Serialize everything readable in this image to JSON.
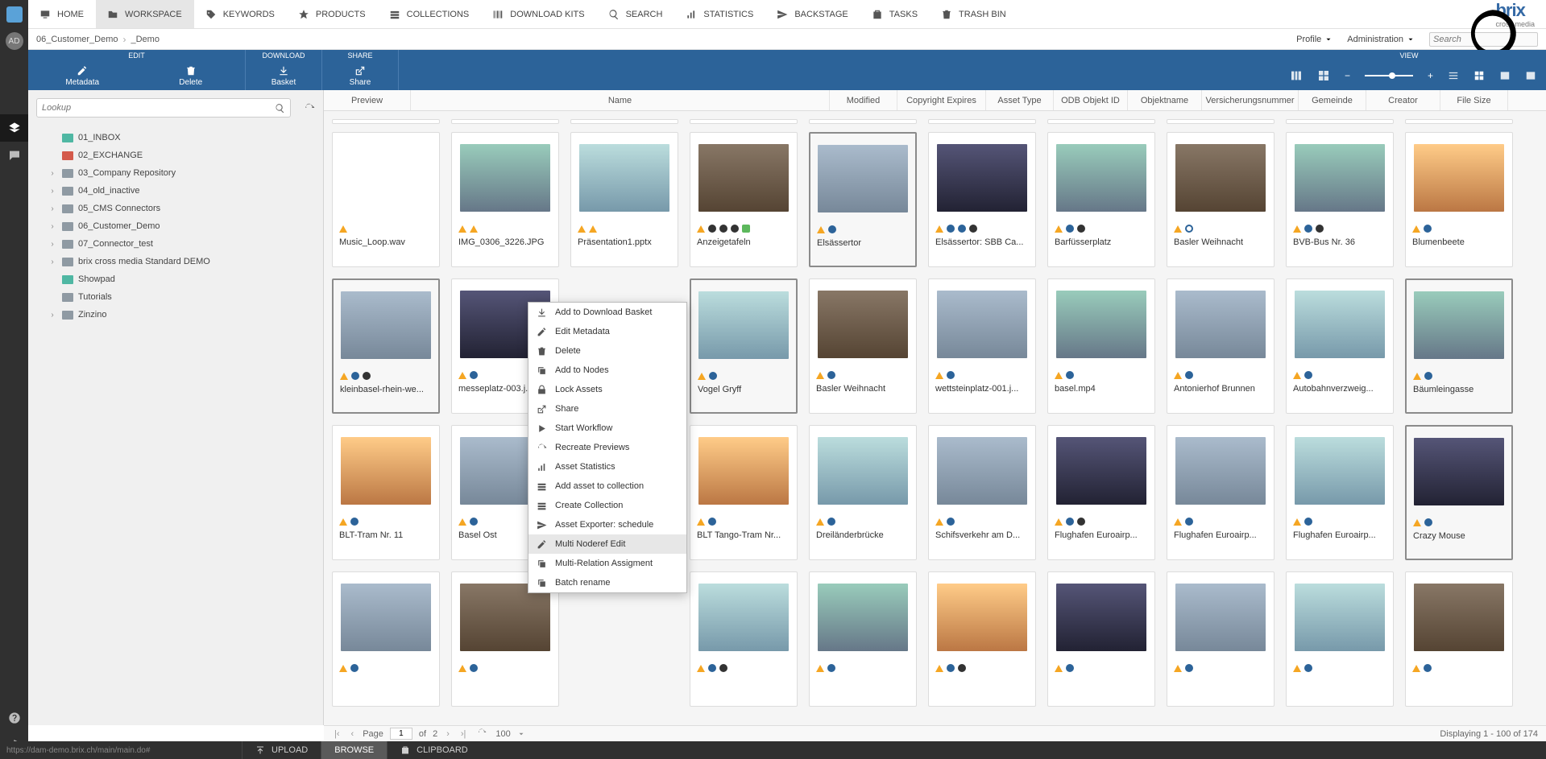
{
  "leftrail": {
    "avatar_initials": "AD"
  },
  "topnav": {
    "items": [
      {
        "label": "HOME",
        "icon": "monitor"
      },
      {
        "label": "WORKSPACE",
        "icon": "folder",
        "active": true
      },
      {
        "label": "KEYWORDS",
        "icon": "tag"
      },
      {
        "label": "PRODUCTS",
        "icon": "star"
      },
      {
        "label": "COLLECTIONS",
        "icon": "stack"
      },
      {
        "label": "DOWNLOAD KITS",
        "icon": "barcode"
      },
      {
        "label": "SEARCH",
        "icon": "search"
      },
      {
        "label": "STATISTICS",
        "icon": "bars"
      },
      {
        "label": "BACKSTAGE",
        "icon": "send"
      },
      {
        "label": "TASKS",
        "icon": "clipboard"
      },
      {
        "label": "TRASH BIN",
        "icon": "trash"
      }
    ],
    "brand_top": "brix",
    "brand_sub": "cross media"
  },
  "crumb": {
    "items": [
      "06_Customer_Demo",
      "_Demo"
    ],
    "profile_label": "Profile",
    "admin_label": "Administration",
    "search_placeholder": "Search"
  },
  "labelrow": {
    "edit": "EDIT",
    "download": "DOWNLOAD",
    "share": "SHARE",
    "view": "VIEW"
  },
  "actions": {
    "metadata": "Metadata",
    "delete": "Delete",
    "basket": "Basket",
    "share": "Share"
  },
  "gridcols": [
    "Preview",
    "Name",
    "Modified",
    "Copyright Expires",
    "Asset Type",
    "ODB Objekt ID",
    "Objektname",
    "Versicherungsnummer",
    "Gemeinde",
    "Creator",
    "File Size"
  ],
  "lookup": {
    "placeholder": "Lookup"
  },
  "tree": [
    {
      "label": "01_INBOX",
      "fld": "teal",
      "caret": false,
      "indent": 1
    },
    {
      "label": "02_EXCHANGE",
      "fld": "red",
      "caret": false,
      "indent": 1
    },
    {
      "label": "03_Company Repository",
      "fld": "gray",
      "caret": true,
      "indent": 1
    },
    {
      "label": "04_old_inactive",
      "fld": "gray",
      "caret": true,
      "indent": 1
    },
    {
      "label": "05_CMS Connectors",
      "fld": "gray",
      "caret": true,
      "indent": 1
    },
    {
      "label": "06_Customer_Demo",
      "fld": "gray",
      "caret": true,
      "indent": 1
    },
    {
      "label": "07_Connector_test",
      "fld": "gray",
      "caret": true,
      "indent": 1
    },
    {
      "label": "brix cross media Standard DEMO",
      "fld": "gray",
      "caret": true,
      "indent": 1
    },
    {
      "label": "Showpad",
      "fld": "teal",
      "caret": false,
      "indent": 1
    },
    {
      "label": "Tutorials",
      "fld": "gray",
      "caret": false,
      "indent": 1
    },
    {
      "label": "Zinzino",
      "fld": "gray",
      "caret": true,
      "indent": 1
    }
  ],
  "assets_row1": [
    {
      "name": "Music_Loop.wav",
      "sel": false,
      "cls": "im-audio",
      "badges": [
        "warn"
      ]
    },
    {
      "name": "IMG_0306_3226.JPG",
      "sel": false,
      "cls": "im",
      "badges": [
        "warn",
        "warn"
      ]
    },
    {
      "name": "Präsentation1.pptx",
      "sel": false,
      "cls": "im5",
      "badges": [
        "warn",
        "warn"
      ]
    },
    {
      "name": "Anzeigetafeln",
      "sel": false,
      "cls": "im4",
      "badges": [
        "warn",
        "gear",
        "gear",
        "gear",
        "green"
      ]
    },
    {
      "name": "Elsässertor",
      "sel": true,
      "cls": "im2",
      "badges": [
        "warn",
        "dot"
      ]
    },
    {
      "name": "Elsässertor: SBB Ca...",
      "sel": false,
      "cls": "im3",
      "badges": [
        "warn",
        "dot",
        "dot",
        "gear"
      ]
    },
    {
      "name": "Barfüsserplatz",
      "sel": false,
      "cls": "im",
      "badges": [
        "warn",
        "dot",
        "gear"
      ]
    },
    {
      "name": "Basler Weihnacht",
      "sel": false,
      "cls": "im4",
      "badges": [
        "warn",
        "dot-o"
      ]
    },
    {
      "name": "BVB-Bus Nr. 36",
      "sel": false,
      "cls": "im",
      "badges": [
        "warn",
        "dot",
        "gear"
      ]
    },
    {
      "name": "Blumenbeete",
      "sel": false,
      "cls": "im6",
      "badges": [
        "warn",
        "dot"
      ]
    }
  ],
  "assets_row2": [
    {
      "name": "kleinbasel-rhein-we...",
      "sel": true,
      "cls": "im2",
      "badges": [
        "warn",
        "dot",
        "gear"
      ]
    },
    {
      "name": "messeplatz-003.j...",
      "sel": false,
      "cls": "im3",
      "badges": [
        "warn",
        "dot"
      ]
    },
    {
      "name": "",
      "sel": false,
      "cls": "",
      "badges": [],
      "blank": true
    },
    {
      "name": "Vogel Gryff",
      "sel": true,
      "cls": "im5",
      "badges": [
        "warn",
        "dot"
      ]
    },
    {
      "name": "Basler Weihnacht",
      "sel": false,
      "cls": "im4",
      "badges": [
        "warn",
        "dot"
      ]
    },
    {
      "name": "wettsteinplatz-001.j...",
      "sel": false,
      "cls": "im2",
      "badges": [
        "warn",
        "dot"
      ]
    },
    {
      "name": "basel.mp4",
      "sel": false,
      "cls": "im",
      "badges": [
        "warn",
        "dot"
      ]
    },
    {
      "name": "Antonierhof Brunnen",
      "sel": false,
      "cls": "im2",
      "badges": [
        "warn",
        "dot"
      ]
    },
    {
      "name": "Autobahnverzweig...",
      "sel": false,
      "cls": "im5",
      "badges": [
        "warn",
        "dot"
      ]
    },
    {
      "name": "Bäumleingasse",
      "sel": true,
      "cls": "im",
      "badges": [
        "warn",
        "dot"
      ]
    }
  ],
  "assets_row3": [
    {
      "name": "BLT-Tram Nr. 11",
      "sel": false,
      "cls": "im6",
      "badges": [
        "warn",
        "dot"
      ]
    },
    {
      "name": "Basel Ost",
      "sel": false,
      "cls": "im2",
      "badges": [
        "warn",
        "dot"
      ]
    },
    {
      "name": "",
      "sel": false,
      "cls": "",
      "badges": [],
      "blank": true
    },
    {
      "name": "BLT Tango-Tram Nr...",
      "sel": false,
      "cls": "im6",
      "badges": [
        "warn",
        "dot"
      ]
    },
    {
      "name": "Dreiländerbrücke",
      "sel": false,
      "cls": "im5",
      "badges": [
        "warn",
        "dot"
      ]
    },
    {
      "name": "Schifsverkehr am D...",
      "sel": false,
      "cls": "im2",
      "badges": [
        "warn",
        "dot"
      ]
    },
    {
      "name": "Flughafen Euroairp...",
      "sel": false,
      "cls": "im3",
      "badges": [
        "warn",
        "dot",
        "gear"
      ]
    },
    {
      "name": "Flughafen Euroairp...",
      "sel": false,
      "cls": "im2",
      "badges": [
        "warn",
        "dot"
      ]
    },
    {
      "name": "Flughafen Euroairp...",
      "sel": false,
      "cls": "im5",
      "badges": [
        "warn",
        "dot"
      ]
    },
    {
      "name": "Crazy Mouse",
      "sel": true,
      "cls": "im3",
      "badges": [
        "warn",
        "dot"
      ]
    }
  ],
  "assets_row4": [
    {
      "name": "",
      "sel": false,
      "cls": "im2",
      "badges": [
        "warn",
        "dot"
      ]
    },
    {
      "name": "",
      "sel": false,
      "cls": "im4",
      "badges": [
        "warn",
        "dot"
      ]
    },
    {
      "name": "",
      "sel": false,
      "cls": "",
      "badges": [],
      "blank": true
    },
    {
      "name": "",
      "sel": false,
      "cls": "im5",
      "badges": [
        "warn",
        "dot",
        "gear"
      ]
    },
    {
      "name": "",
      "sel": false,
      "cls": "im",
      "badges": [
        "warn",
        "dot"
      ]
    },
    {
      "name": "",
      "sel": false,
      "cls": "im6",
      "badges": [
        "warn",
        "dot",
        "gear"
      ]
    },
    {
      "name": "",
      "sel": false,
      "cls": "im3",
      "badges": [
        "warn",
        "dot"
      ]
    },
    {
      "name": "",
      "sel": false,
      "cls": "im2",
      "badges": [
        "warn",
        "dot"
      ]
    },
    {
      "name": "",
      "sel": false,
      "cls": "im5",
      "badges": [
        "warn",
        "dot"
      ]
    },
    {
      "name": "",
      "sel": false,
      "cls": "im4",
      "badges": [
        "warn",
        "dot"
      ]
    }
  ],
  "context_menu": [
    {
      "label": "Add to Download Basket",
      "icon": "download"
    },
    {
      "label": "Edit Metadata",
      "icon": "edit"
    },
    {
      "label": "Delete",
      "icon": "trash"
    },
    {
      "label": "Add to Nodes",
      "icon": "copy"
    },
    {
      "label": "Lock Assets",
      "icon": "lock"
    },
    {
      "label": "Share",
      "icon": "share"
    },
    {
      "label": "Start Workflow",
      "icon": "play"
    },
    {
      "label": "Recreate Previews",
      "icon": "refresh"
    },
    {
      "label": "Asset Statistics",
      "icon": "bars"
    },
    {
      "label": "Add asset to collection",
      "icon": "stack"
    },
    {
      "label": "Create Collection",
      "icon": "stack"
    },
    {
      "label": "Asset Exporter: schedule",
      "icon": "send"
    },
    {
      "label": "Multi Noderef Edit",
      "icon": "edit",
      "highlight": true
    },
    {
      "label": "Multi-Relation Assigment",
      "icon": "copy"
    },
    {
      "label": "Batch rename",
      "icon": "copy"
    }
  ],
  "pager": {
    "page_label": "Page",
    "of_label": "of",
    "page": "1",
    "total": "2",
    "size": "100",
    "display": "Displaying 1 - 100 of 174"
  },
  "bottombar": {
    "status": "https://dam-demo.brix.ch/main/main.do#",
    "upload": "UPLOAD",
    "browse": "BROWSE",
    "clipboard": "CLIPBOARD"
  }
}
